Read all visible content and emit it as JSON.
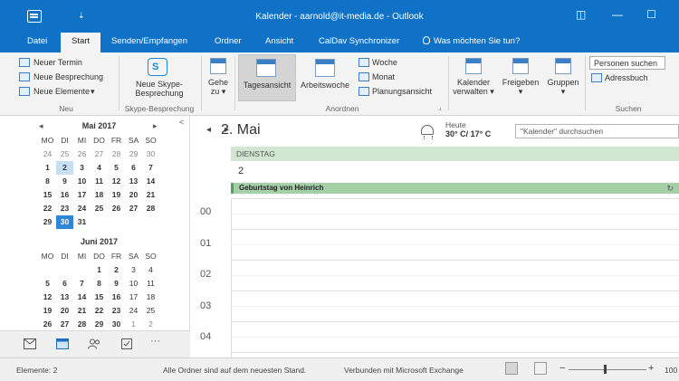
{
  "window": {
    "title": "Kalender - aarnold@it-media.de - Outlook",
    "qat": "⇣",
    "restore": "◫",
    "minimize": "—",
    "maximize": "☐"
  },
  "tabs": [
    "Datei",
    "Start",
    "Senden/Empfangen",
    "Ordner",
    "Ansicht",
    "CalDav Synchronizer"
  ],
  "active_tab": "Start",
  "tell_me": "Was möchten Sie tun?",
  "ribbon": {
    "neu": {
      "items": [
        "Neuer Termin",
        "Neue Besprechung",
        "Neue Elemente"
      ],
      "label": "Neu"
    },
    "skype": {
      "button": [
        "Neue Skype-",
        "Besprechung"
      ],
      "label": "Skype-Besprechung"
    },
    "gehe_zu": [
      "Gehe",
      "zu"
    ],
    "anordnen": {
      "day_view": "Tagesansicht",
      "work_week": "Arbeitswoche",
      "week": "Woche",
      "month": "Monat",
      "schedule": "Planungsansicht",
      "label": "Anordnen"
    },
    "verwalten": {
      "calendar": [
        "Kalender",
        "verwalten"
      ],
      "share": "Freigeben",
      "groups": "Gruppen"
    },
    "suchen": {
      "people_placeholder": "Personen suchen",
      "address_book": "Adressbuch",
      "label": "Suchen"
    }
  },
  "mini_calendar": {
    "collapse": "<",
    "prev": "◂",
    "next": "▸",
    "weekdays": [
      "MO",
      "DI",
      "MI",
      "DO",
      "FR",
      "SA",
      "SO"
    ],
    "months": [
      {
        "name": "Mai 2017",
        "weeks": [
          [
            "24",
            "25",
            "26",
            "27",
            "28",
            "29",
            "30"
          ],
          [
            "1",
            "2",
            "3",
            "4",
            "5",
            "6",
            "7"
          ],
          [
            "8",
            "9",
            "10",
            "11",
            "12",
            "13",
            "14"
          ],
          [
            "15",
            "16",
            "17",
            "18",
            "19",
            "20",
            "21"
          ],
          [
            "22",
            "23",
            "24",
            "25",
            "26",
            "27",
            "28"
          ],
          [
            "29",
            "30",
            "31"
          ]
        ]
      },
      {
        "name": "Juni 2017",
        "weeks": [
          [
            "",
            "",
            "",
            "1",
            "2",
            "3",
            "4"
          ],
          [
            "5",
            "6",
            "7",
            "8",
            "9",
            "10",
            "11"
          ],
          [
            "12",
            "13",
            "14",
            "15",
            "16",
            "17",
            "18"
          ],
          [
            "19",
            "20",
            "21",
            "22",
            "23",
            "24",
            "25"
          ],
          [
            "26",
            "27",
            "28",
            "29",
            "30",
            "1",
            "2"
          ]
        ]
      }
    ]
  },
  "calendar": {
    "prev": "◂",
    "next": "▸",
    "date_title": "2. Mai",
    "weather_label": "Heute",
    "weather_temp": "30° C/ 17° C",
    "search_placeholder": "\"Kalender\" durchsuchen",
    "day_name": "DIENSTAG",
    "day_number": "2",
    "all_day_event": "Geburtstag von Heinrich",
    "recurring_glyph": "↻",
    "hours": [
      "00",
      "01",
      "02",
      "03",
      "04"
    ]
  },
  "statusbar": {
    "items": "Elemente: 2",
    "sync": "Alle Ordner sind auf dem neuesten Stand.",
    "connection": "Verbunden mit Microsoft Exchange",
    "zoom_minus": "−",
    "zoom_plus": "+",
    "zoom": "100"
  }
}
